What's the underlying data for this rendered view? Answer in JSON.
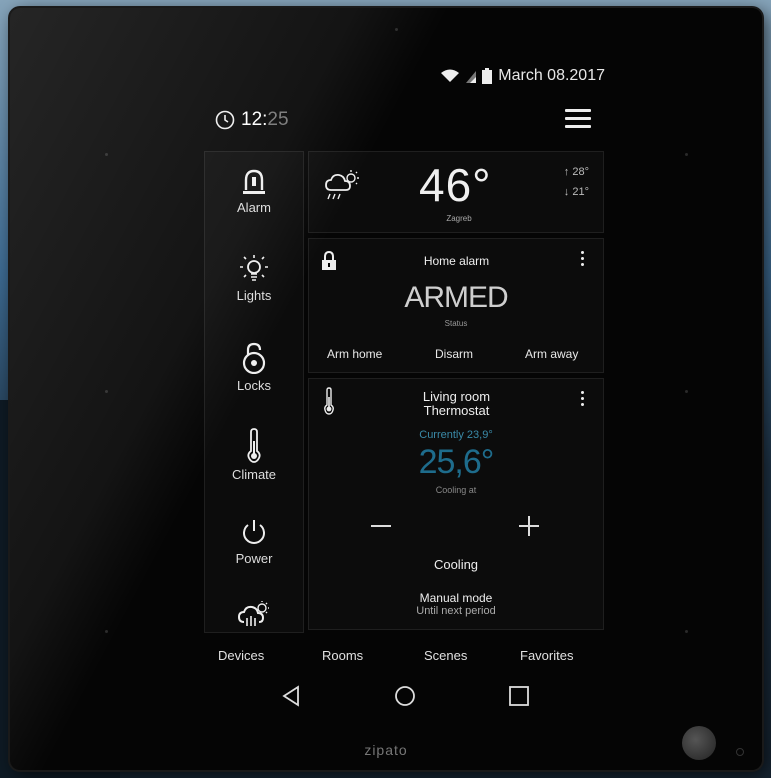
{
  "status": {
    "date": "March 08.2017"
  },
  "clock": {
    "hours": "12",
    "separator": ":",
    "minutes": "25"
  },
  "sidebar": {
    "items": [
      {
        "label": "Alarm",
        "icon": "alarm-icon"
      },
      {
        "label": "Lights",
        "icon": "lightbulb-icon"
      },
      {
        "label": "Locks",
        "icon": "lock-icon"
      },
      {
        "label": "Climate",
        "icon": "thermometer-icon"
      },
      {
        "label": "Power",
        "icon": "power-icon"
      },
      {
        "label": "",
        "icon": "weather-icon"
      }
    ]
  },
  "weather": {
    "temperature": "46°",
    "city": "Zagreb",
    "high": "↑ 28°",
    "low": "↓ 21°",
    "icon": "partly-cloudy-rain-icon"
  },
  "alarm": {
    "title": "Home alarm",
    "state": "ARMED",
    "status_label": "Status",
    "buttons": [
      "Arm home",
      "Disarm",
      "Arm away"
    ]
  },
  "thermostat": {
    "title_line1": "Living room",
    "title_line2": "Thermostat",
    "current": "Currently 23,9°",
    "setpoint": "25,6°",
    "cooling_at": "Cooling at",
    "mode": "Cooling",
    "manual_mode": "Manual mode",
    "manual_sub": "Until next period"
  },
  "tabs": [
    "Devices",
    "Rooms",
    "Scenes",
    "Favorites"
  ],
  "brand": "zipato",
  "colors": {
    "accent": "#1e6c8c",
    "background": "#050505"
  }
}
